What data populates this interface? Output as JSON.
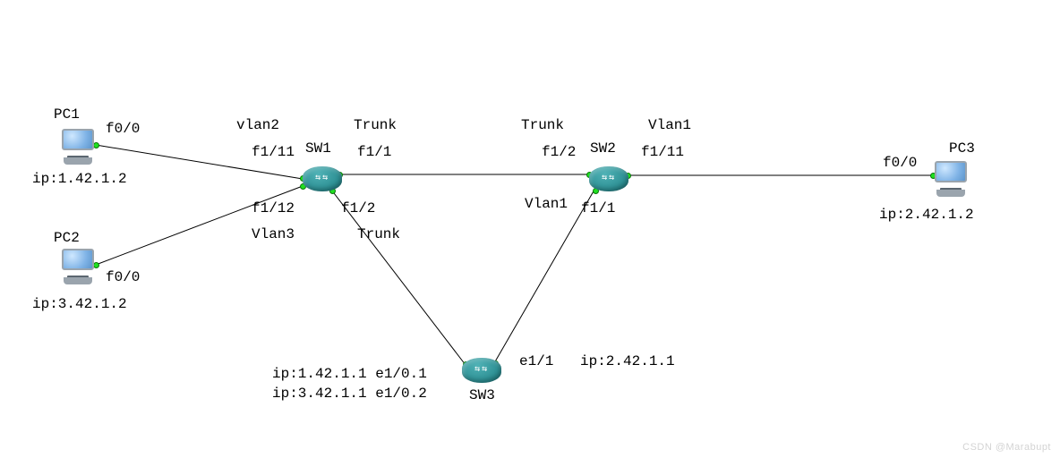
{
  "chart_data": {
    "type": "network-diagram",
    "nodes": [
      {
        "id": "PC1",
        "type": "pc",
        "ip": "1.42.1.2",
        "port": "f0/0"
      },
      {
        "id": "PC2",
        "type": "pc",
        "ip": "3.42.1.2",
        "port": "f0/0"
      },
      {
        "id": "PC3",
        "type": "pc",
        "ip": "2.42.1.2",
        "port": "f0/0"
      },
      {
        "id": "SW1",
        "type": "switch"
      },
      {
        "id": "SW2",
        "type": "switch"
      },
      {
        "id": "SW3",
        "type": "switch",
        "subif": [
          {
            "iface": "e1/0.1",
            "ip": "1.42.1.1"
          },
          {
            "iface": "e1/0.2",
            "ip": "3.42.1.1"
          }
        ],
        "routed_port": {
          "iface": "e1/1",
          "ip": "2.42.1.1"
        }
      }
    ],
    "links": [
      {
        "a": "PC1 f0/0",
        "b": "SW1 f1/11",
        "b_vlan": "vlan2"
      },
      {
        "a": "PC2 f0/0",
        "b": "SW1 f1/12",
        "b_vlan": "Vlan3"
      },
      {
        "a": "SW1 f1/1",
        "b": "SW2 f1/2",
        "mode": "Trunk"
      },
      {
        "a": "SW1 f1/2",
        "b": "SW3 e1/0",
        "mode": "Trunk"
      },
      {
        "a": "SW2 f1/1",
        "b": "SW3 e1/1",
        "b_vlan": "Vlan1"
      },
      {
        "a": "SW2 f1/11",
        "b": "PC3 f0/0",
        "a_vlan": "Vlan1"
      }
    ]
  },
  "labels": {
    "pc1_name": "PC1",
    "pc1_if": "f0/0",
    "pc1_ip": "ip:1.42.1.2",
    "pc2_name": "PC2",
    "pc2_if": "f0/0",
    "pc2_ip": "ip:3.42.1.2",
    "pc3_name": "PC3",
    "pc3_if": "f0/0",
    "pc3_ip": "ip:2.42.1.2",
    "sw1_name": "SW1",
    "sw1_f111": "f1/11",
    "sw1_f11": "f1/1",
    "sw1_f112": "f1/12",
    "sw1_f12": "f1/2",
    "sw1_vlan2": "vlan2",
    "sw1_vlan3": "Vlan3",
    "sw1_trunk_right": "Trunk",
    "sw1_trunk_down": "Trunk",
    "sw2_name": "SW2",
    "sw2_f12": "f1/2",
    "sw2_f111": "f1/11",
    "sw2_f11": "f1/1",
    "sw2_vlan1_right": "Vlan1",
    "sw2_vlan1_down": "Vlan1",
    "sw2_trunk": "Trunk",
    "sw3_name": "SW3",
    "sw3_sub1": "ip:1.42.1.1 e1/0.1",
    "sw3_sub2": "ip:3.42.1.1 e1/0.2",
    "sw3_e11": "e1/1",
    "sw3_e11_ip": "ip:2.42.1.1"
  },
  "watermark": "CSDN @Marabupt"
}
